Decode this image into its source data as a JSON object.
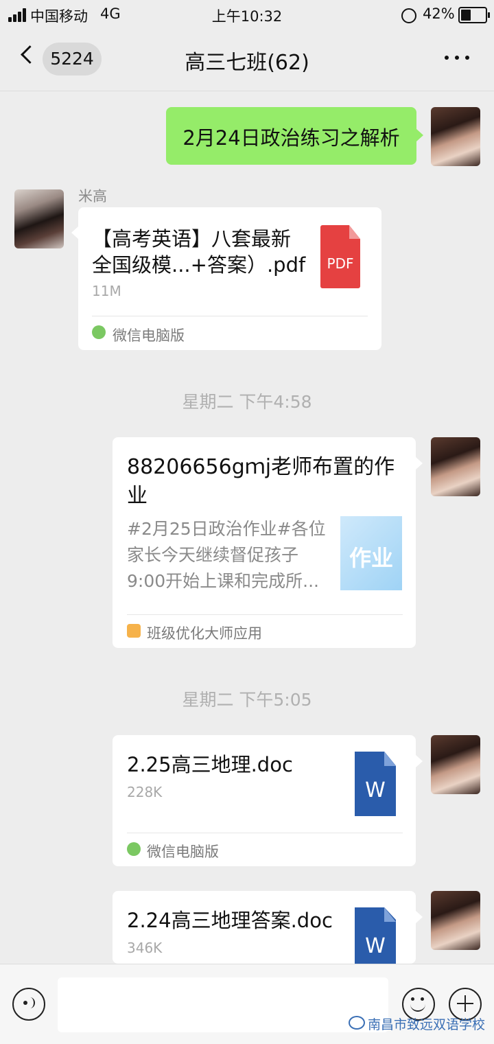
{
  "status_bar": {
    "carrier": "中国移动",
    "network": "4G",
    "time": "上午10:32",
    "battery": "42%"
  },
  "nav": {
    "back_count": "5224",
    "title": "高三七班(62)"
  },
  "messages": {
    "m1": {
      "text": "2月24日政治练习之解析"
    },
    "m2": {
      "sender": "米高",
      "title_line1": "【高考英语】八套最新",
      "title_line2": "全国级模...+答案）.pdf",
      "size": "11M",
      "icon_label": "PDF",
      "source": "微信电脑版"
    },
    "t1": "星期二 下午4:58",
    "m3": {
      "title_line1": "88206656gｍj老师布置的作",
      "title_line2": "业",
      "desc_line1": "#2月25日政治作业#各位",
      "desc_line2": "家长今天继续督促孩子",
      "desc_line3": "9:00开始上课和完成所...",
      "thumb_text": "作业",
      "source": "班级优化大师应用"
    },
    "t2": "星期二 下午5:05",
    "m4": {
      "title": "2.25高三地理.doc",
      "size": "228K",
      "icon_label": "W",
      "source": "微信电脑版"
    },
    "m5": {
      "title": "2.24高三地理答案.doc",
      "size": "346K",
      "icon_label": "W"
    }
  },
  "watermark": "南昌市致远双语学校",
  "colors": {
    "my_bubble": "#95ec69",
    "pdf": "#e54141",
    "word": "#2a5cab"
  },
  "icons": [
    "back-icon",
    "more-icon",
    "voice-icon",
    "emoji-icon",
    "add-icon",
    "pdf-file-icon",
    "word-file-icon",
    "wechat-icon"
  ]
}
